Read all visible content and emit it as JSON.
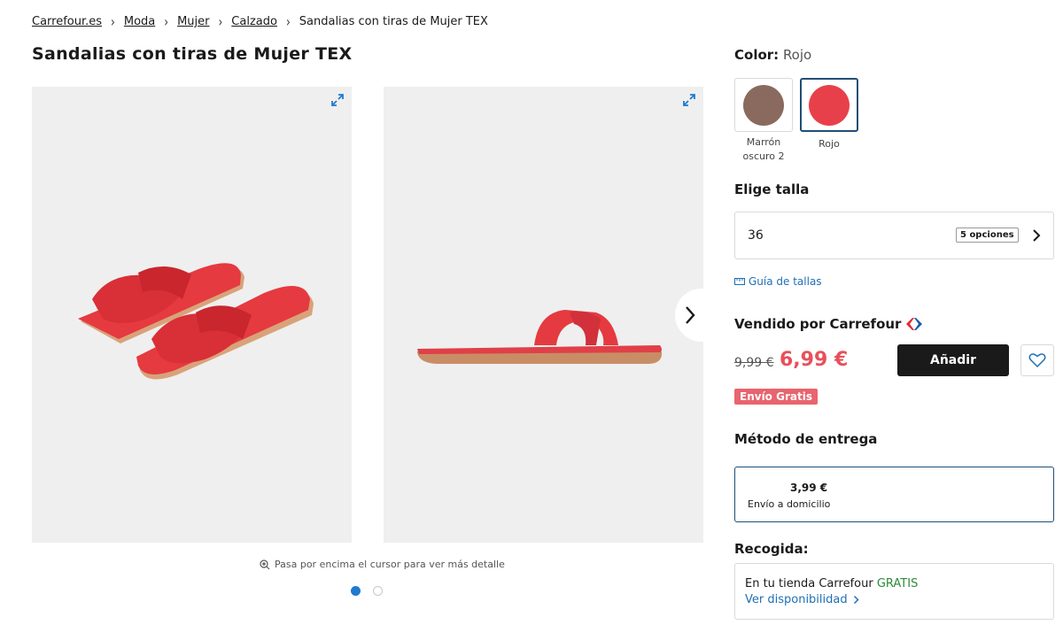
{
  "breadcrumb": {
    "items": [
      "Carrefour.es",
      "Moda",
      "Mujer",
      "Calzado"
    ],
    "current": "Sandalias con tiras de Mujer TEX"
  },
  "product": {
    "title": "Sandalias con tiras de Mujer TEX"
  },
  "gallery": {
    "hover_hint": "Pasa por encima el cursor para ver más detalle",
    "pagination": {
      "current": 1,
      "total": 2
    }
  },
  "color": {
    "label": "Color:",
    "selected": "Rojo",
    "options": [
      {
        "label": "Marrón oscuro 2",
        "color": "#8a6a5e"
      },
      {
        "label": "Rojo",
        "color": "#e8404a"
      }
    ]
  },
  "size": {
    "title": "Elige talla",
    "selected": "36",
    "options_badge": "5 opciones",
    "guide_label": "Guía de tallas"
  },
  "seller": {
    "label": "Vendido por Carrefour"
  },
  "price": {
    "old": "9,99 €",
    "new": "6,99 €",
    "add_label": "Añadir",
    "free_shipping": "Envío Gratis"
  },
  "delivery": {
    "title": "Método de entrega",
    "price": "3,99 €",
    "desc": "Envío a domicilio"
  },
  "pickup": {
    "title": "Recogida:",
    "line_prefix": "En tu tienda Carrefour ",
    "line_gratis": "GRATIS",
    "availability": "Ver disponibilidad"
  },
  "colors": {
    "accent": "#1f7ad1",
    "price_red": "#e8505b",
    "badge_red": "#e8646e",
    "link_blue": "#1f6fb5"
  }
}
